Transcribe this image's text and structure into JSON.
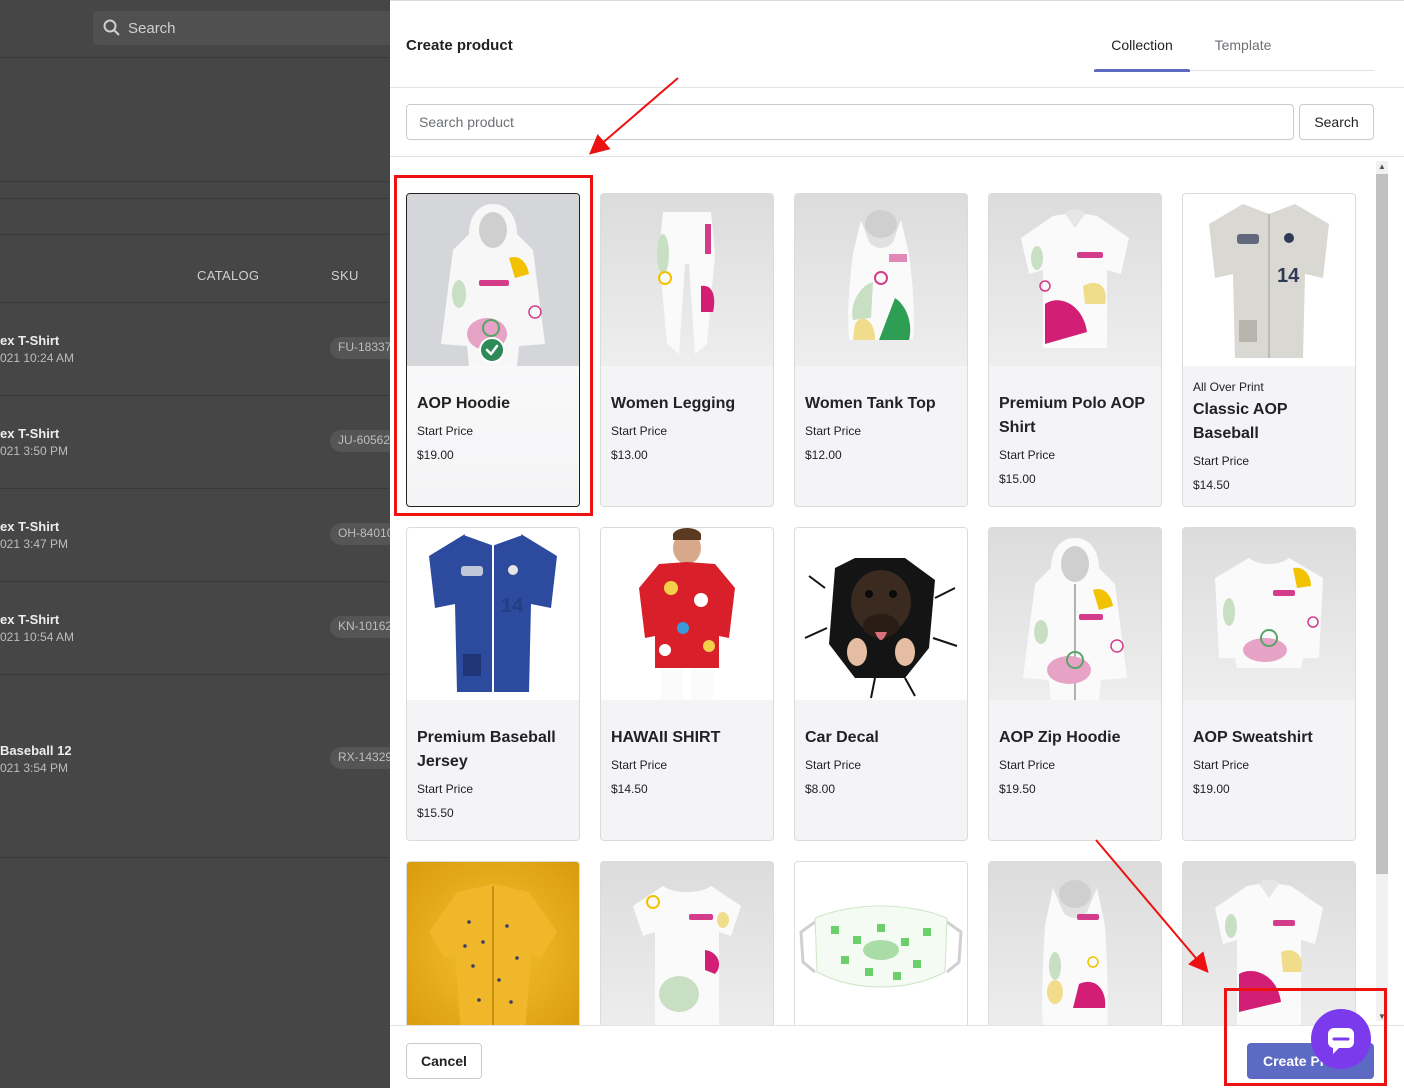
{
  "background": {
    "search_label": "Search",
    "columns": {
      "catalog": "CATALOG",
      "sku": "SKU"
    },
    "rows": [
      {
        "name": "ex T-Shirt",
        "date": "021 10:24 AM",
        "sku": "FU-18337"
      },
      {
        "name": "ex T-Shirt",
        "date": "021 3:50 PM",
        "sku": "JU-60562"
      },
      {
        "name": "ex T-Shirt",
        "date": "021 3:47 PM",
        "sku": "OH-84010"
      },
      {
        "name": "ex T-Shirt",
        "date": "021 10:54 AM",
        "sku": "KN-10162"
      },
      {
        "name": "Baseball 12",
        "date": "021 3:54 PM",
        "sku": "RX-14329"
      }
    ]
  },
  "modal": {
    "title": "Create product",
    "tabs": [
      {
        "label": "Collection",
        "active": true
      },
      {
        "label": "Template",
        "active": false
      }
    ],
    "search": {
      "placeholder": "Search product",
      "button": "Search"
    },
    "price_label": "Start Price",
    "products": [
      {
        "name": "AOP Hoodie",
        "price": "$19.00",
        "selected": true
      },
      {
        "name": "Women Legging",
        "price": "$13.00"
      },
      {
        "name": "Women Tank Top",
        "price": "$12.00"
      },
      {
        "name": "Premium Polo AOP Shirt",
        "price": "$15.00"
      },
      {
        "name": "Classic AOP Baseball",
        "price": "$14.50",
        "eyebrow": "All Over Print"
      },
      {
        "name": "Premium Baseball Jersey",
        "price": "$15.50"
      },
      {
        "name": "HAWAII SHIRT",
        "price": "$14.50"
      },
      {
        "name": "Car Decal",
        "price": "$8.00"
      },
      {
        "name": "AOP Zip Hoodie",
        "price": "$19.50"
      },
      {
        "name": "AOP Sweatshirt",
        "price": "$19.00"
      }
    ],
    "partial_row_thumbnails": [
      "yellow-shirt-image",
      "t-shirt-image",
      "face-mask-image",
      "tank-top-image",
      "polo-shirt-image"
    ],
    "footer": {
      "cancel": "Cancel",
      "create": "Create Pr"
    }
  },
  "colors": {
    "accent": "#5c6ac4",
    "annotation": "#ee1111",
    "chat": "#7c3aed",
    "selected_check": "#2e8b57"
  }
}
